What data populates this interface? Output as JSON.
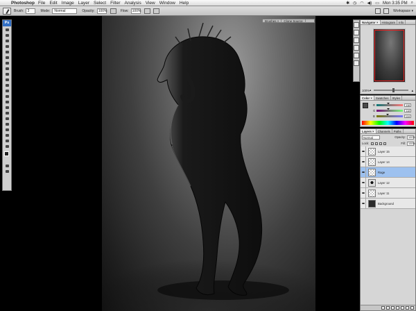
{
  "menubar": {
    "apple": "",
    "app": "Photoshop",
    "menus": [
      "File",
      "Edit",
      "Image",
      "Layer",
      "Select",
      "Filter",
      "Analysis",
      "View",
      "Window",
      "Help"
    ],
    "clock": "Mon 3:35 PM"
  },
  "options": {
    "brush_label": "Brush:",
    "brush_size": "3",
    "mode_label": "Mode:",
    "mode_value": "Normal",
    "opacity_label": "Opacity:",
    "opacity_value": "100%",
    "flow_label": "Flow:",
    "flow_value": "100%",
    "workspace": "Workspace ▾"
  },
  "toolbox": {
    "logo": "Ps"
  },
  "brushtab": {
    "tabs": [
      "Brushes ×",
      "Clone Source"
    ]
  },
  "navigator": {
    "tabs": [
      "Navigator ×",
      "Histogram",
      "Info"
    ],
    "zoom": "100%"
  },
  "color": {
    "tabs": [
      "Color ×",
      "Swatches",
      "Styles"
    ],
    "channels": [
      {
        "label": "R",
        "value": "118"
      },
      {
        "label": "G",
        "value": "118"
      },
      {
        "label": "B",
        "value": "118"
      }
    ]
  },
  "layers": {
    "tabs": [
      "Layers ×",
      "Channels",
      "Paths"
    ],
    "blend": "Normal",
    "opacity_label": "Opacity:",
    "opacity": "100%",
    "lock_label": "Lock:",
    "fill_label": "Fill:",
    "fill": "100%",
    "items": [
      {
        "name": "Layer 15",
        "thumb": "trans",
        "selected": false
      },
      {
        "name": "Layer 14",
        "thumb": "trans",
        "selected": false
      },
      {
        "name": "Rage",
        "thumb": "trans",
        "selected": true
      },
      {
        "name": "Layer 12",
        "thumb": "fig",
        "selected": false
      },
      {
        "name": "Layer 11",
        "thumb": "trans",
        "selected": false
      },
      {
        "name": "Background",
        "thumb": "dark",
        "selected": false
      }
    ]
  }
}
